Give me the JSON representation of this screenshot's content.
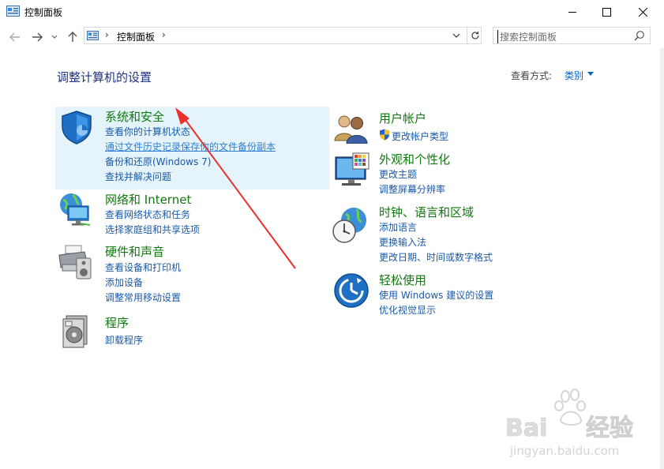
{
  "window": {
    "title": "控制面板"
  },
  "address": {
    "path": "控制面板"
  },
  "search": {
    "placeholder": "搜索控制面板"
  },
  "page": {
    "heading": "调整计算机的设置"
  },
  "view": {
    "label": "查看方式:",
    "value": "类别"
  },
  "categories": [
    {
      "title": "系统和安全",
      "links": [
        "查看你的计算机状态",
        "通过文件历史记录保存你的文件备份副本",
        "备份和还原(Windows 7)",
        "查找并解决问题"
      ]
    },
    {
      "title": "网络和 Internet",
      "links": [
        "查看网络状态和任务",
        "选择家庭组和共享选项"
      ]
    },
    {
      "title": "硬件和声音",
      "links": [
        "查看设备和打印机",
        "添加设备",
        "调整常用移动设置"
      ]
    },
    {
      "title": "程序",
      "links": [
        "卸载程序"
      ]
    },
    {
      "title": "用户帐户",
      "links": [
        "更改帐户类型"
      ]
    },
    {
      "title": "外观和个性化",
      "links": [
        "更改主题",
        "调整屏幕分辨率"
      ]
    },
    {
      "title": "时钟、语言和区域",
      "links": [
        "添加语言",
        "更换输入法",
        "更改日期、时间或数字格式"
      ]
    },
    {
      "title": "轻松使用",
      "links": [
        "使用 Windows 建议的设置",
        "优化视觉显示"
      ]
    }
  ],
  "watermark": {
    "brand": "Baidu经验",
    "url": "jingyan.baidu.com"
  }
}
